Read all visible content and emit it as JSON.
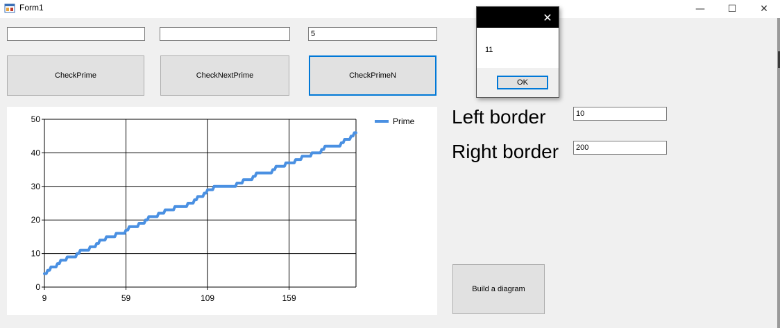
{
  "window": {
    "title": "Form1",
    "controls": {
      "minimize": "—",
      "maximize": "☐",
      "close": "✕"
    }
  },
  "inputs": {
    "first": "",
    "second": "",
    "third": "5",
    "left_border": "10",
    "right_border": "200"
  },
  "buttons": {
    "check_prime": "CheckPrime",
    "check_next_prime": "CheckNextPrime",
    "check_prime_n": "CheckPrimeN",
    "build_diagram": "Build a diagram"
  },
  "labels": {
    "left_border": "Left border",
    "right_border": "Right border"
  },
  "message_box": {
    "text": "11",
    "ok": "OK",
    "close": "✕"
  },
  "colors": {
    "series": "#4a90e2",
    "focus": "#0078d7"
  },
  "chart_data": {
    "type": "line",
    "title": "",
    "xlabel": "",
    "ylabel": "",
    "xlim": [
      9,
      200
    ],
    "ylim": [
      0,
      50
    ],
    "x_ticks": [
      9,
      59,
      109,
      159
    ],
    "y_ticks": [
      0,
      10,
      20,
      30,
      40,
      50
    ],
    "grid": true,
    "legend_position": "top-right",
    "series": [
      {
        "name": "Prime",
        "color": "#4a90e2",
        "x": [
          9,
          11,
          13,
          17,
          19,
          23,
          29,
          31,
          37,
          41,
          43,
          47,
          53,
          59,
          61,
          67,
          71,
          73,
          79,
          83,
          89,
          97,
          101,
          103,
          107,
          109,
          113,
          127,
          131,
          137,
          139,
          149,
          151,
          157,
          163,
          167,
          173,
          179,
          181,
          191,
          193,
          197,
          199,
          200
        ],
        "values": [
          4,
          5,
          6,
          7,
          8,
          9,
          10,
          11,
          12,
          13,
          14,
          15,
          16,
          17,
          18,
          19,
          20,
          21,
          22,
          23,
          24,
          25,
          26,
          27,
          28,
          29,
          30,
          31,
          32,
          33,
          34,
          35,
          36,
          37,
          38,
          39,
          40,
          41,
          42,
          43,
          44,
          45,
          46,
          46
        ]
      }
    ]
  }
}
